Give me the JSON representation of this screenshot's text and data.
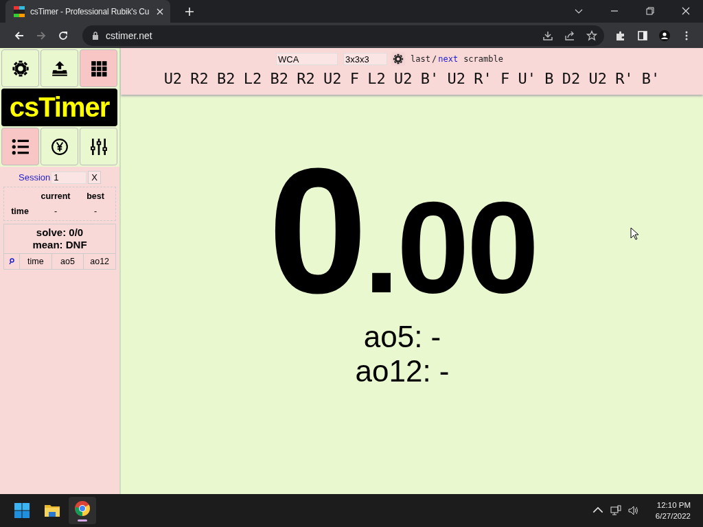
{
  "browser": {
    "tab_title": "csTimer - Professional Rubik's Cu",
    "url": "cstimer.net"
  },
  "toolbar": {
    "buttons": [
      {
        "kind": "settings",
        "selected": false
      },
      {
        "kind": "export",
        "selected": false
      },
      {
        "kind": "scramble",
        "selected": true
      }
    ],
    "logo": "csTimer",
    "buttons_2": [
      {
        "kind": "stats",
        "selected": true
      },
      {
        "kind": "donate",
        "selected": false
      },
      {
        "kind": "tools",
        "selected": false
      }
    ]
  },
  "session": {
    "label": "Session",
    "value": "1",
    "clear": "X",
    "summary_columns": [
      "current",
      "best"
    ],
    "summary_rows": [
      {
        "label": "time",
        "current": "-",
        "best": "-"
      }
    ],
    "solve": "solve: 0/0",
    "mean": "mean: DNF",
    "list_columns": [
      "time",
      "ao5",
      "ao12"
    ]
  },
  "scramble": {
    "type": "WCA",
    "puzzle": "3x3x3",
    "last": "last",
    "separator": "/",
    "next": "next",
    "suffix": "scramble",
    "moves": "U2 R2 B2 L2 B2 R2 U2 F L2 U2 B' U2 R' F U' B D2 U2 R' B'"
  },
  "timer": {
    "seconds": "0",
    "fraction": ".00",
    "ao5": "ao5: -",
    "ao12": "ao12: -"
  },
  "taskbar": {
    "time": "12:10 PM",
    "date": "6/27/2022"
  }
}
